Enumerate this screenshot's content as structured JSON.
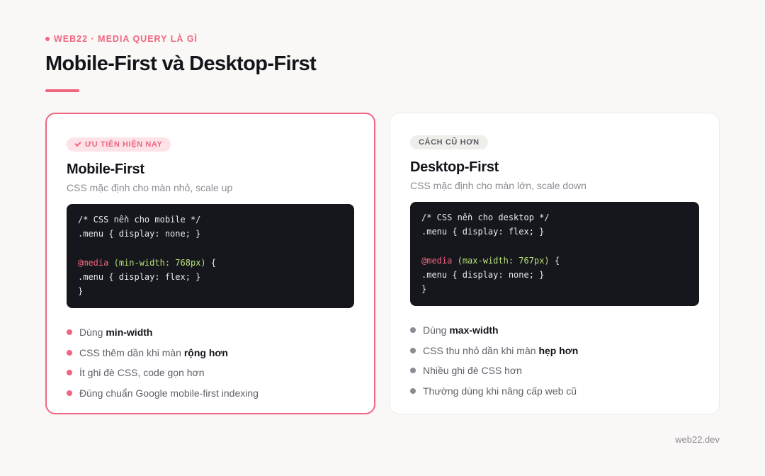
{
  "header": {
    "eyebrow": "WEB22 · MEDIA QUERY LÀ GÌ",
    "title": "Mobile-First và Desktop-First"
  },
  "cards": [
    {
      "badge": "ƯU TIÊN HIỆN NAY",
      "badge_icon": "check-icon",
      "title": "Mobile-First",
      "subtitle": "CSS mặc định cho màn nhỏ, scale up",
      "code": {
        "line1": "/* CSS nền cho mobile */",
        "line2": ".menu { display: none; }",
        "media_kw": "@media",
        "media_cond": "(min-width: 768px)",
        "media_brace": "{",
        "line4": ".menu { display: flex; }",
        "line5": "}"
      },
      "bullets": [
        {
          "pre": "Dùng ",
          "bold": "min-width",
          "post": ""
        },
        {
          "pre": "CSS thêm dần khi màn ",
          "bold": "rộng hơn",
          "post": ""
        },
        {
          "pre": "Ít ghi đè CSS, code gọn hơn",
          "bold": "",
          "post": ""
        },
        {
          "pre": "Đúng chuẩn Google mobile-first indexing",
          "bold": "",
          "post": ""
        }
      ]
    },
    {
      "badge": "CÁCH CŨ HƠN",
      "title": "Desktop-First",
      "subtitle": "CSS mặc định cho màn lớn, scale down",
      "code": {
        "line1": "/* CSS nền cho desktop */",
        "line2": ".menu { display: flex; }",
        "media_kw": "@media",
        "media_cond": "(max-width: 767px)",
        "media_brace": "{",
        "line4": ".menu { display: none; }",
        "line5": "}"
      },
      "bullets": [
        {
          "pre": "Dùng ",
          "bold": "max-width",
          "post": ""
        },
        {
          "pre": "CSS thu nhỏ dần khi màn ",
          "bold": "hẹp hơn",
          "post": ""
        },
        {
          "pre": "Nhiều ghi đè CSS hơn",
          "bold": "",
          "post": ""
        },
        {
          "pre": "Thường dùng khi nâng cấp web cũ",
          "bold": "",
          "post": ""
        }
      ]
    }
  ],
  "footer": {
    "brand": "web22.dev"
  },
  "colors": {
    "accent": "#f0657f",
    "code_bg": "#16171c",
    "code_condition": "#b7e07a",
    "muted": "#8b8c93"
  }
}
